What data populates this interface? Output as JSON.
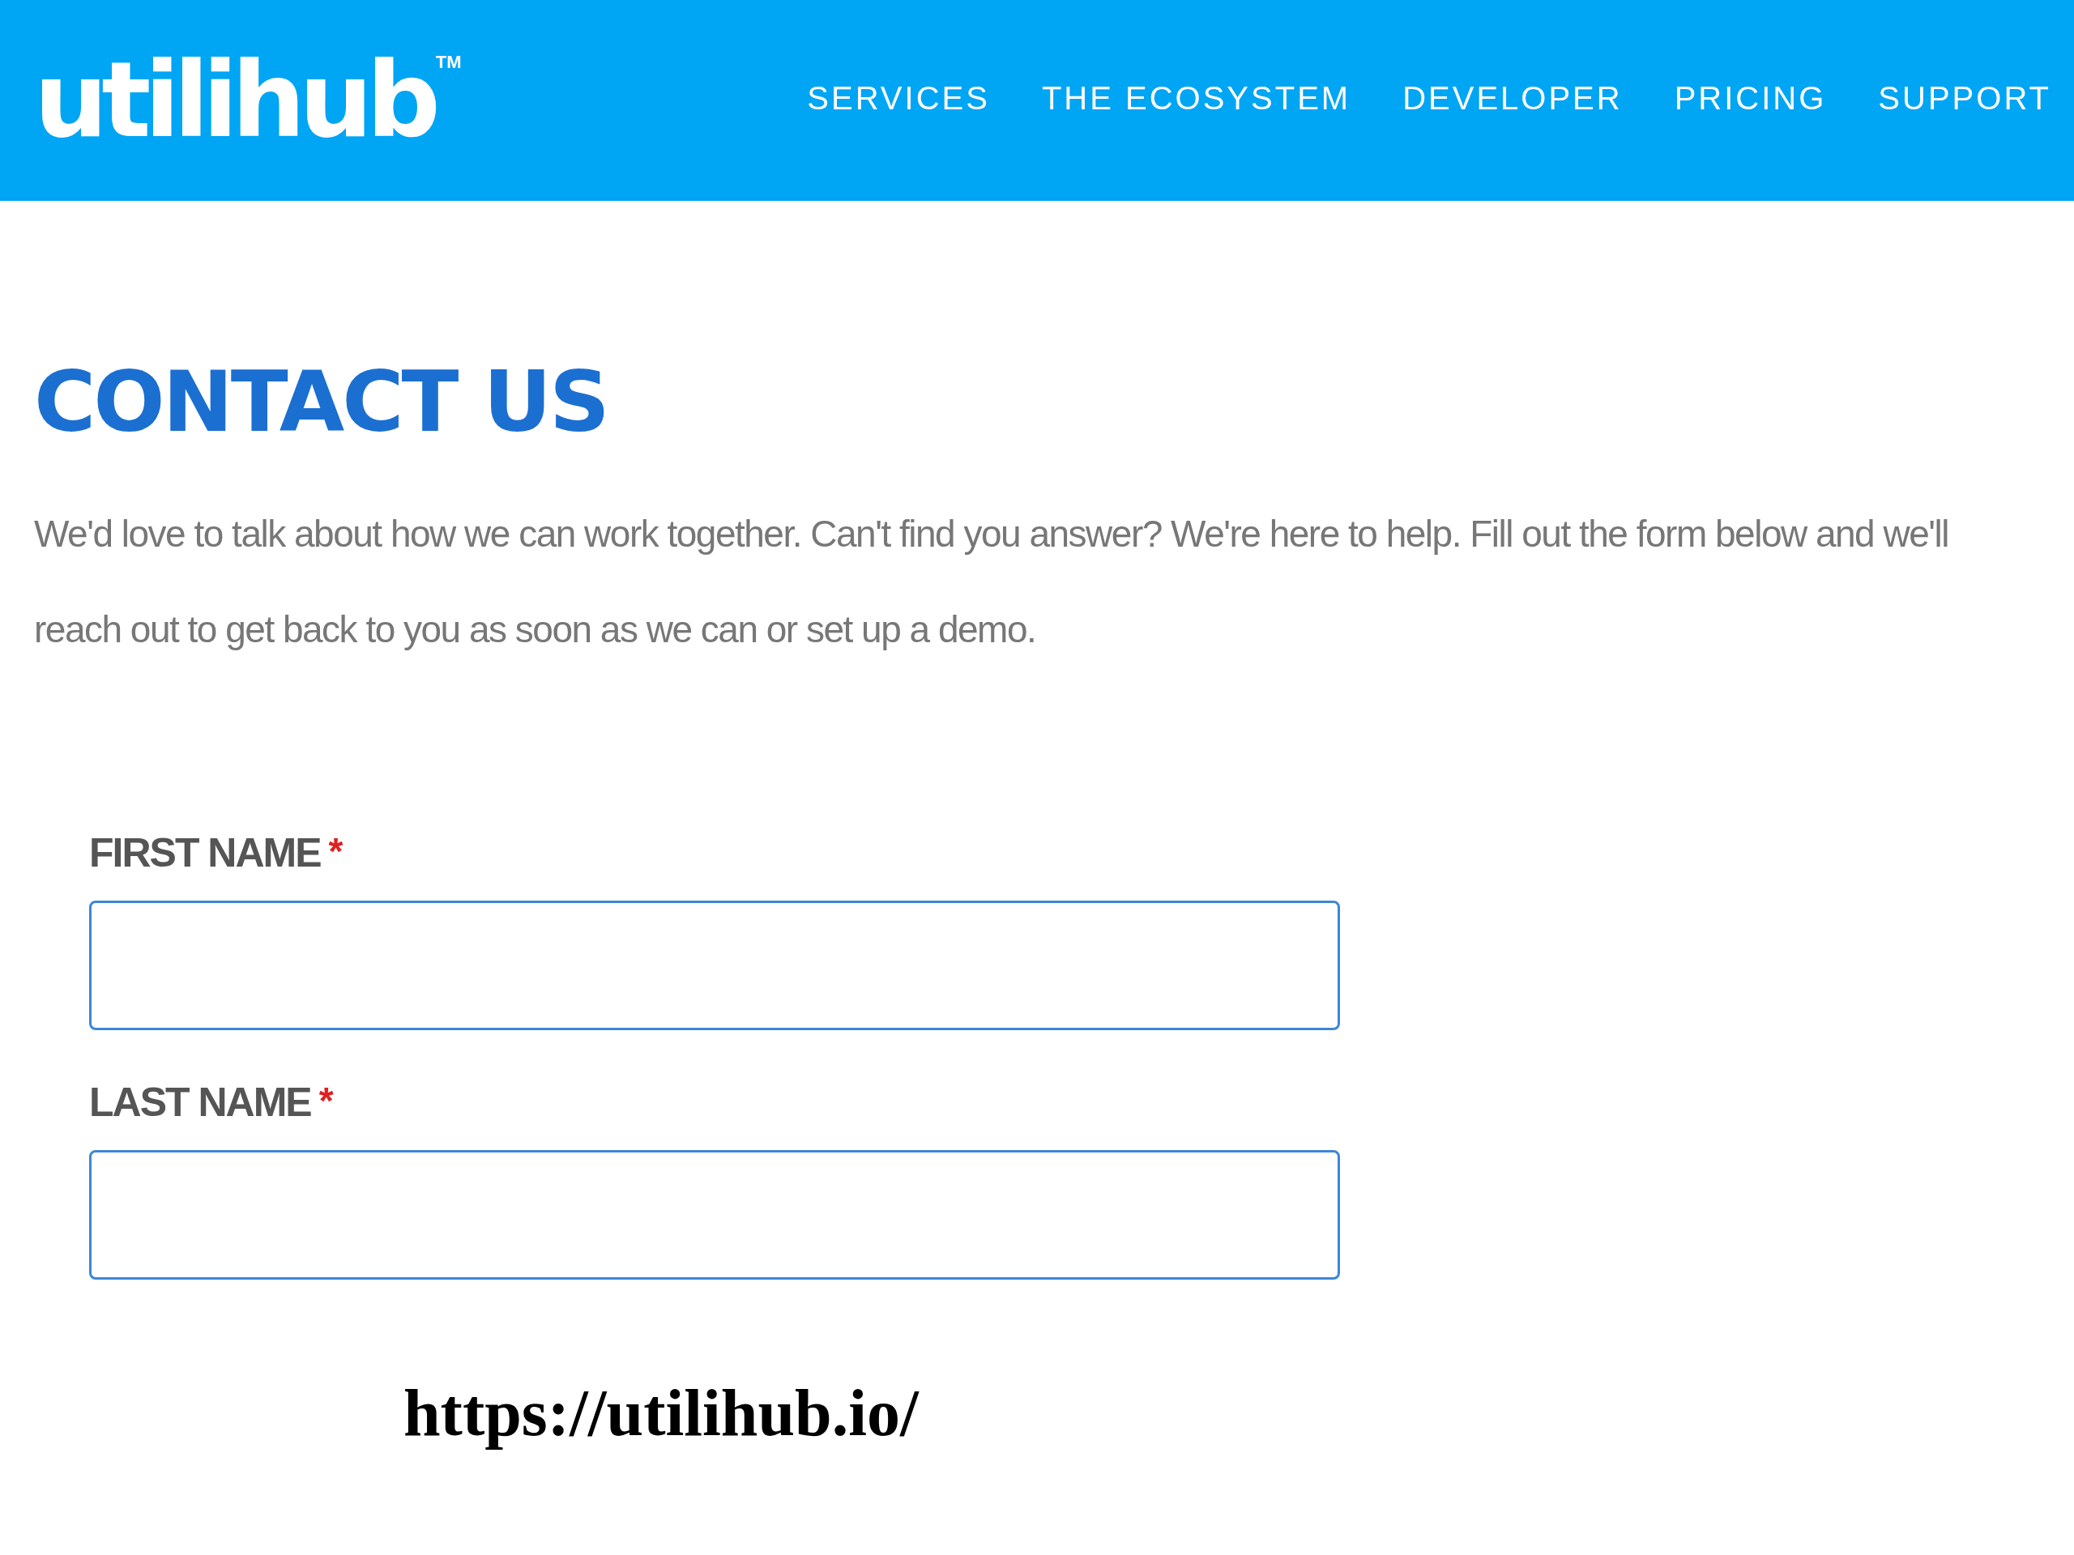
{
  "header": {
    "logo": "utilihub",
    "trademark": "TM",
    "nav": [
      {
        "label": "SERVICES"
      },
      {
        "label": "THE ECOSYSTEM"
      },
      {
        "label": "DEVELOPER"
      },
      {
        "label": "PRICING"
      },
      {
        "label": "SUPPORT"
      }
    ]
  },
  "heading": "CONTACT US",
  "intro": "We'd love to talk about how we can work together. Can't find you answer? We're here to help. Fill out the form below and we'll reach out to get back to you as soon as we can or set up a demo.",
  "fields": [
    {
      "label": "FIRST NAME",
      "required_mark": "*"
    },
    {
      "label": "LAST NAME",
      "required_mark": "*"
    }
  ],
  "caption": "https://utilihub.io/"
}
